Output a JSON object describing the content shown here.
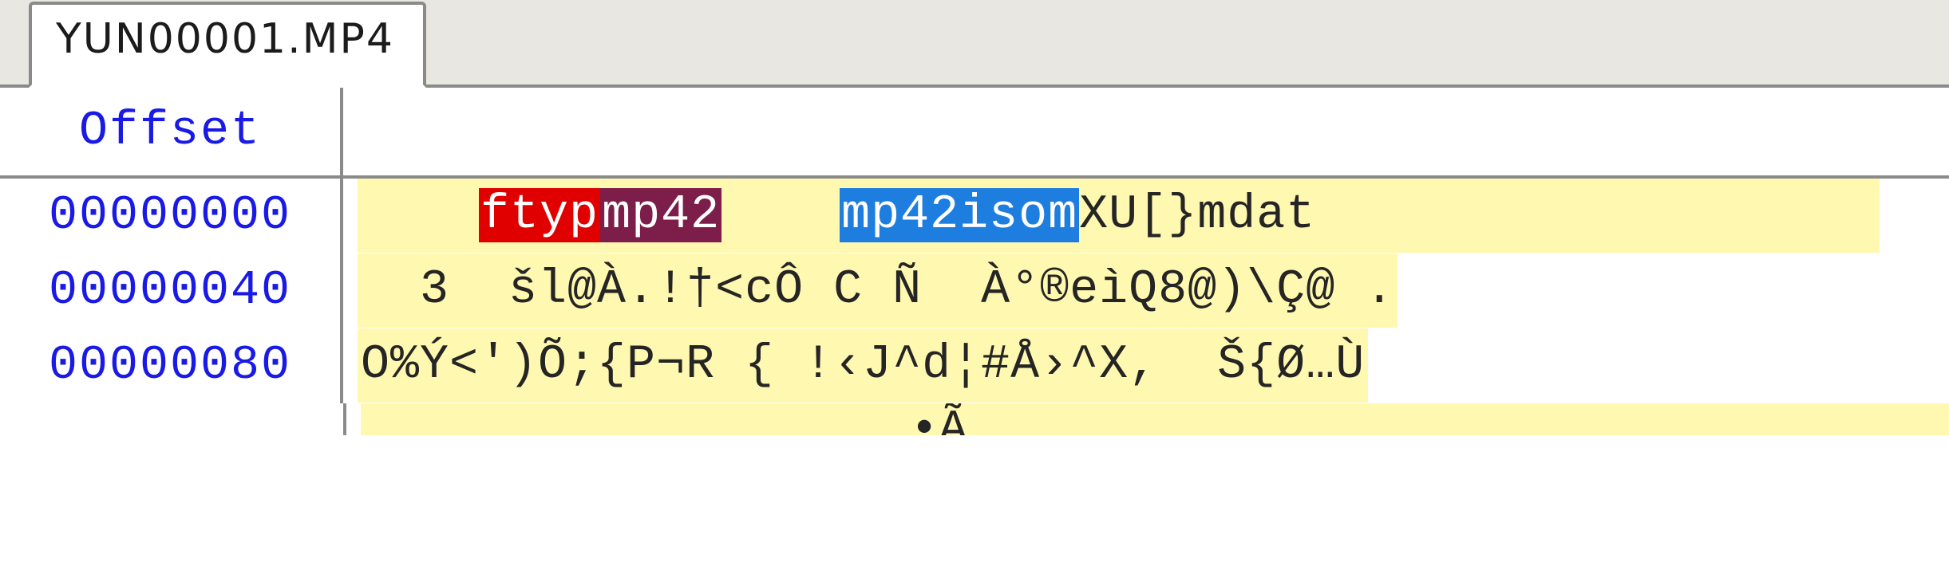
{
  "tab": {
    "label": "YUN00001.MP4"
  },
  "header": {
    "offset_label": "Offset"
  },
  "rows": [
    {
      "offset": "00000000",
      "segments": [
        {
          "text": "    ",
          "kind": "plain"
        },
        {
          "text": "ftyp",
          "kind": "red"
        },
        {
          "text": "mp42",
          "kind": "maroon"
        },
        {
          "text": "    ",
          "kind": "plain"
        },
        {
          "text": "mp42isom",
          "kind": "blue"
        },
        {
          "text": "XU[}mdat                   ",
          "kind": "plain"
        }
      ]
    },
    {
      "offset": "00000040",
      "segments": [
        {
          "text": "  3  šl@À.!†<cÔ C Ñ  À°®eìQ8@)\\Ç@ .",
          "kind": "plain"
        }
      ]
    },
    {
      "offset": "00000080",
      "segments": [
        {
          "text": "O%Ý<')Õ;{P¬R { !‹J^d¦#Å›^X,  Š{Ø…Ù",
          "kind": "plain"
        }
      ]
    }
  ],
  "peek_text": "                   •Ã                                  "
}
